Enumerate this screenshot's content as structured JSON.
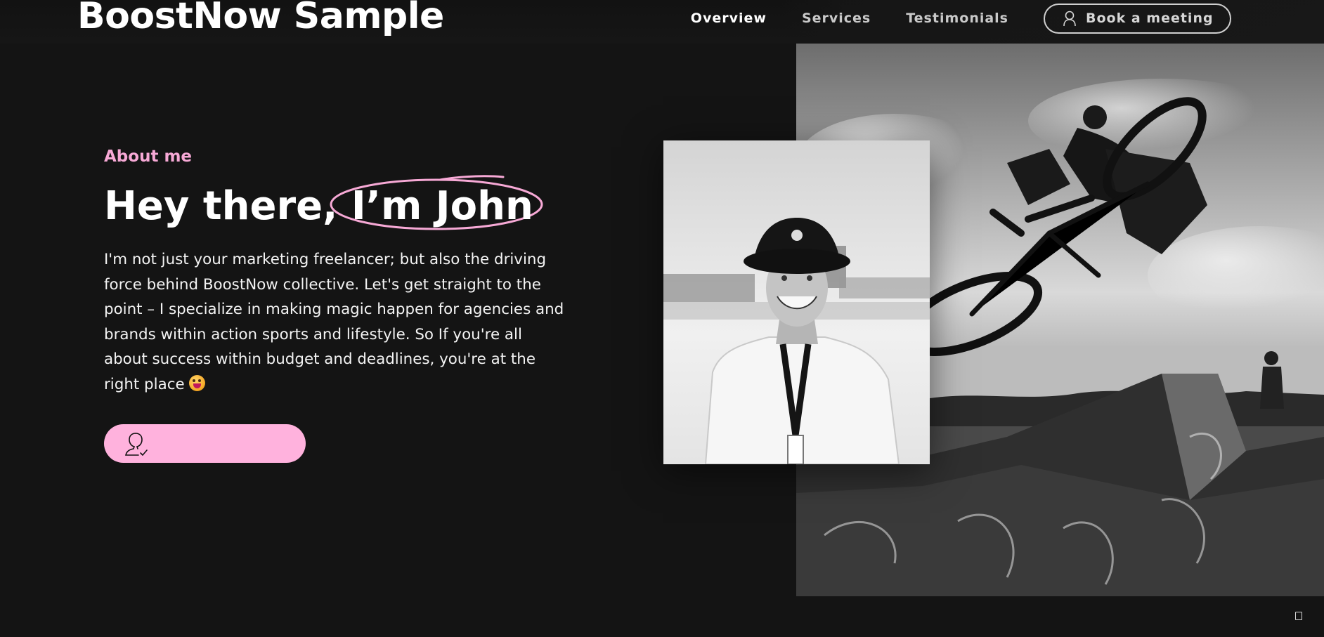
{
  "header": {
    "brand": "BoostNow Sample",
    "nav": [
      {
        "label": "Overview",
        "active": true
      },
      {
        "label": "Services",
        "active": false
      },
      {
        "label": "Testimonials",
        "active": false
      }
    ],
    "cta": {
      "label": "Book a meeting",
      "icon": "person-icon"
    }
  },
  "hero": {
    "eyebrow": "About me",
    "headline_prefix": "Hey there,",
    "headline_highlight": "I’m John",
    "bio": "I'm not just your marketing freelancer; but also the driving force behind BoostNow collective. Let's get straight to the point – I specialize in making magic happen for agencies and brands within action sports and lifestyle. So If you're all about success within budget and deadlines, you're at the right place",
    "bio_emoji": "winking-face-with-tongue-emoji",
    "button": {
      "label": "",
      "icon": "person-check-icon"
    }
  },
  "images": {
    "portrait": "black-and-white-portrait-of-man-in-bucket-hat",
    "background": "black-and-white-bmx-rider-mid-air-over-ramp"
  },
  "colors": {
    "background": "#141414",
    "accent_pink": "#f7a9d6",
    "button_pink": "#ffb2dd",
    "text": "#ffffff"
  }
}
